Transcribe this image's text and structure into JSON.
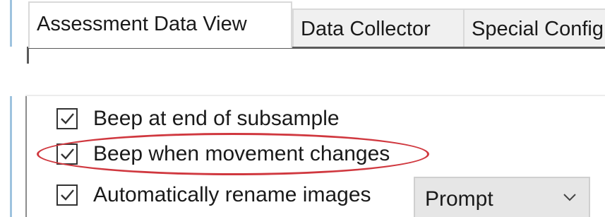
{
  "tabs": [
    {
      "label": "Assessment Data View",
      "active": true
    },
    {
      "label": "Data Collector",
      "active": false
    },
    {
      "label": "Special Config",
      "active": false
    }
  ],
  "options": [
    {
      "label": "Beep at end of subsample",
      "checked": true,
      "highlighted": false
    },
    {
      "label": "Beep when movement changes",
      "checked": true,
      "highlighted": true
    },
    {
      "label": "Automatically rename images",
      "checked": true,
      "highlighted": false
    }
  ],
  "rename_mode": {
    "selected": "Prompt",
    "icon": "chevron-down-icon"
  },
  "colors": {
    "highlight": "#d0383f",
    "accent": "#9ec3df"
  }
}
